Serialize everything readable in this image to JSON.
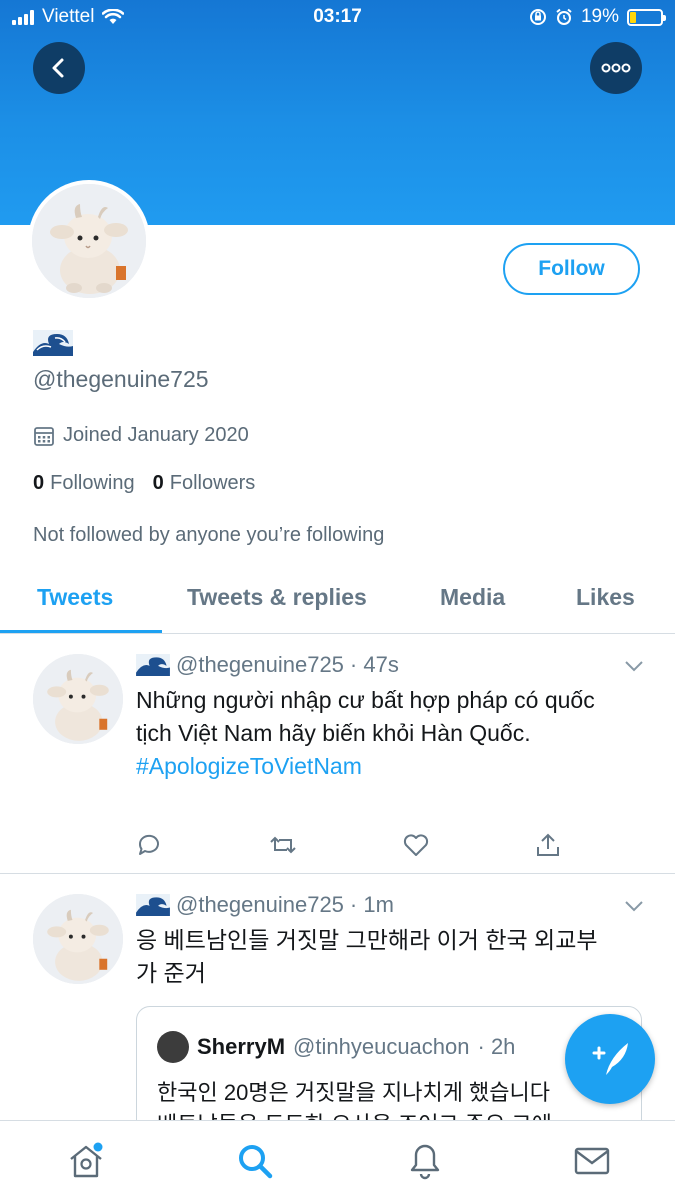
{
  "status_bar": {
    "carrier": "Viettel",
    "time": "03:17",
    "battery_percent": "19%",
    "battery_level": 0.19
  },
  "colors": {
    "accent": "#1da1f2",
    "banner_top": "#1577d4",
    "banner_bottom": "#209bf0",
    "muted_text": "#657786"
  },
  "header": {
    "back_icon": "chevron-left-icon",
    "more_icon": "more-dots-icon"
  },
  "profile": {
    "display_name_emoji": "🌊",
    "handle": "@thegenuine725",
    "joined": "Joined January 2020",
    "following_count": "0",
    "following_label": "Following",
    "followers_count": "0",
    "followers_label": "Followers",
    "not_followed": "Not followed by anyone you’re following",
    "follow_button": "Follow"
  },
  "tabs": [
    {
      "label": "Tweets",
      "active": true
    },
    {
      "label": "Tweets & replies",
      "active": false
    },
    {
      "label": "Media",
      "active": false
    },
    {
      "label": "Likes",
      "active": false
    }
  ],
  "tweets": [
    {
      "emoji": "🌊",
      "handle": "@thegenuine725",
      "time": "· 47s",
      "text": "Những người nhập cư bất hợp pháp có quốc tịch Việt Nam hãy biến khỏi Hàn Quốc.",
      "hashtag": "#ApologizeToVietNam"
    },
    {
      "emoji": "🌊",
      "handle": "@thegenuine725",
      "time": "· 1m",
      "text": "응 베트남인들 거짓말 그만해라 이거 한국 외교부가 준거",
      "quote": {
        "name": "SherryM",
        "handle": "@tinhyeucuachon",
        "time": "· 2h",
        "line1": "한국인 20명은 거짓말을 지나치게 했습니다",
        "line2": "베트남들은 도도한 오사을 조어그 주요 고에"
      }
    }
  ],
  "bottom_nav": [
    "home-icon",
    "search-icon",
    "notifications-bell-icon",
    "messages-envelope-icon"
  ]
}
